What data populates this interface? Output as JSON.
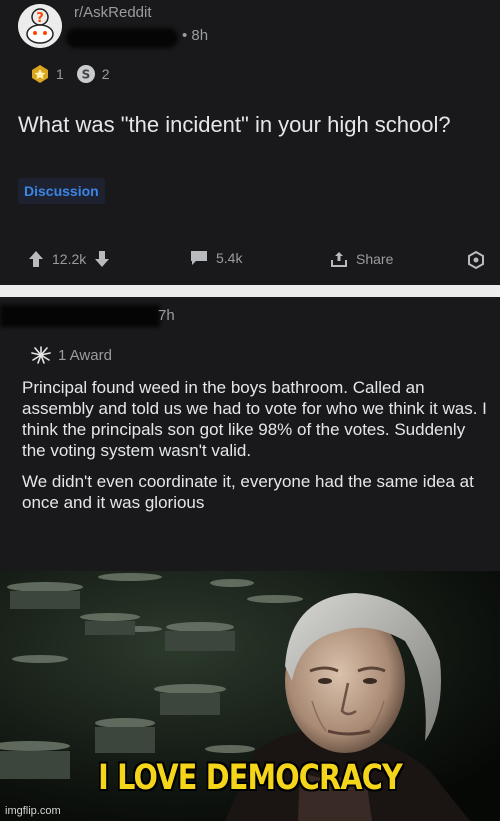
{
  "post": {
    "subreddit": "r/AskReddit",
    "time": "• 8h",
    "awards": [
      {
        "icon": "gold-award-icon",
        "count": "1"
      },
      {
        "icon": "silver-award-icon",
        "count": "2"
      }
    ],
    "title": "What was \"the incident\" in your high school?",
    "flair": "Discussion",
    "upvotes": "12.2k",
    "comments": "5.4k",
    "share_label": "Share"
  },
  "comment": {
    "time": "7h",
    "award_label": "1 Award",
    "paragraphs": [
      "Principal found weed in the boys bathroom. Called an assembly and told us we had to vote for who we think it was. I think the principals son got like 98% of the votes. Suddenly the voting system wasn't valid.",
      "We didn't even coordinate it, everyone had the same idea at once and it was glorious"
    ]
  },
  "meme": {
    "caption": "I LOVE DEMOCRACY",
    "watermark": "imgflip.com"
  },
  "colors": {
    "panel_bg": "#19191b",
    "flair_text": "#3a86e8",
    "caption": "#f4d51a"
  }
}
